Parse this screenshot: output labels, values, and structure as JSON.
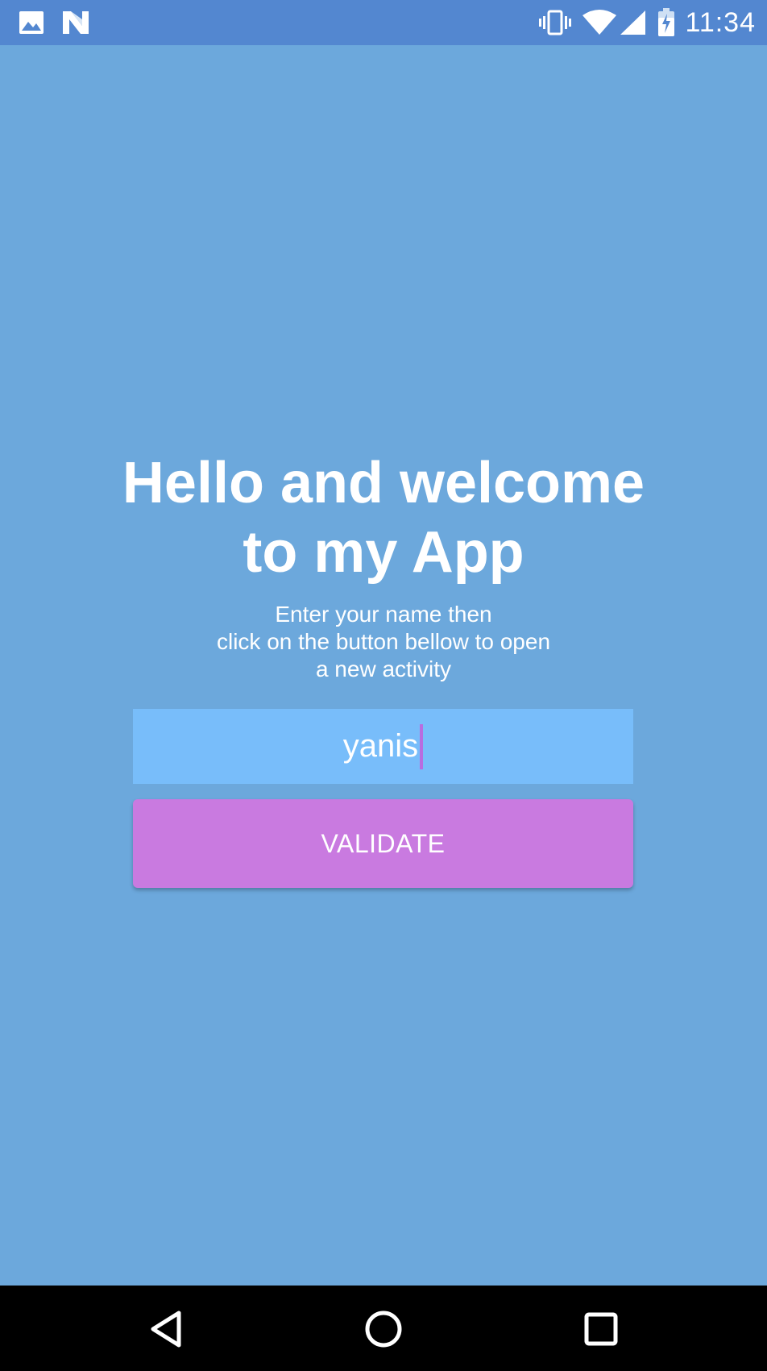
{
  "status_bar": {
    "time": "11:34",
    "left_icons": [
      "image-notification-icon",
      "n-notification-icon"
    ],
    "right_icons": [
      "vibrate-icon",
      "wifi-icon",
      "signal-icon",
      "battery-charging-icon"
    ]
  },
  "main": {
    "title": "Hello and welcome\nto my App",
    "instructions": "Enter your name then\nclick on the button bellow to open\na new activity",
    "name_input": {
      "value": "yanis"
    },
    "validate_label": "VALIDATE"
  },
  "nav_bar": {
    "buttons": [
      "back-icon",
      "home-icon",
      "recents-icon"
    ]
  },
  "colors": {
    "background": "#6ca8dc",
    "status_bar": "#5387d0",
    "input_background": "#78bdfa",
    "button": "#c97ae0",
    "caret": "#b86ce0",
    "nav_bar": "#000000"
  }
}
